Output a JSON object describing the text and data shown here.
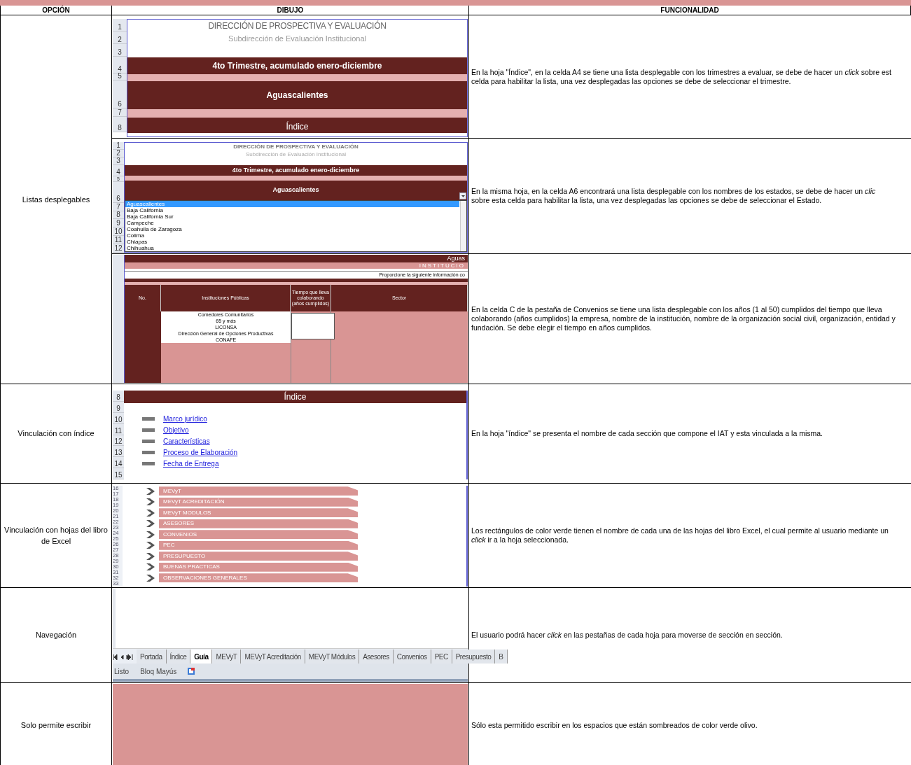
{
  "header": {
    "columns": [
      "OPCIÓN",
      "DIBUJO",
      "FUNCIONALIDAD"
    ]
  },
  "rows": [
    {
      "option": "Listas desplegables",
      "items": [
        {
          "drawing": {
            "kind": "portada",
            "row_numbers": [
              "1",
              "2",
              "3",
              "4",
              "5",
              "6",
              "7",
              "8"
            ],
            "title": "DIRECCIÓN DE PROSPECTIVA Y EVALUACIÓN",
            "subtitle": "Subdirección de Evaluación Institucional",
            "period": "4to Trimestre, acumulado enero-diciembre",
            "state": "Aguascalientes",
            "sheet": "Índice"
          },
          "text": "En la hoja \"Índice\", en la celda A4 se tiene una lista desplegable con los trimestres a evaluar, se debe de hacer un *click* sobre est\ncelda para habilitar la lista, una vez desplegadas las opciones se debe de seleccionar el trimestre."
        },
        {
          "drawing": {
            "kind": "dropdown",
            "row_numbers": [
              "1",
              "2",
              "3",
              "4",
              "5",
              "6",
              "7",
              "8",
              "9",
              "10",
              "11",
              "12"
            ],
            "title": "DIRECCIÓN DE PROSPECTIVA Y EVALUACIÓN",
            "subtitle": "Subdirección de Evaluación Institucional",
            "period": "4to Trimestre, acumulado enero-diciembre",
            "state": "Aguascalientes",
            "options": [
              {
                "label": "Aguascalientes",
                "selected": true
              },
              {
                "label": "Baja California",
                "selected": false
              },
              {
                "label": "Baja California Sur",
                "selected": false
              },
              {
                "label": "Campeche",
                "selected": false
              },
              {
                "label": "Coahuila de Zaragoza",
                "selected": false
              },
              {
                "label": "Colima",
                "selected": false
              },
              {
                "label": "Chiapas",
                "selected": false
              },
              {
                "label": "Chihuahua",
                "selected": false
              }
            ]
          },
          "text": "En la misma hoja, en la celda A6 encontrará una lista desplegable con los nombres de los estados, se debe de hacer un *clic*\nsobre esta celda para habilitar la lista, una vez desplegadas las opciones se debe de seleccionar el Estado."
        },
        {
          "drawing": {
            "kind": "convenios",
            "title": "Aguas",
            "subtitle": "INSTITUCIO",
            "instruction": "Proporcione la siguiente información co",
            "columns": [
              "No.",
              "Instituciones Públicas",
              "Tiempo que lleva colaborando (años cumplidos)",
              "Sector"
            ],
            "institutions": [
              "Comedores Comunitarios",
              "65 y más",
              "LICONSA",
              "Dirección General de Opciones Productivas",
              "CONAFE"
            ]
          },
          "text": "En la celda C de la pestaña de Convenios se tiene una lista desplegable con los años (1 al 50) cumplidos del tiempo que lleva colaborando (años cumplidos) la empresa, nombre de la institución, nombre de la organización social civil, organización, entidad y fundación. Se debe elegir el tiempo en años cumplidos."
        }
      ]
    },
    {
      "option": "Vinculación con índice",
      "items": [
        {
          "drawing": {
            "kind": "indice",
            "row_numbers": [
              "8",
              "9",
              "10",
              "11",
              "12",
              "13",
              "14",
              "15"
            ],
            "heading": "Índice",
            "links": [
              "Marco jurídico",
              "Objetivo",
              "Características",
              "Proceso de Elaboración",
              "Fecha de Entrega"
            ]
          },
          "text": "En la hoja \"índice\" se presenta el nombre de cada sección que compone el IAT y esta vinculada a la misma."
        }
      ]
    },
    {
      "option": "Vinculación con hojas del libro de Excel",
      "items": [
        {
          "drawing": {
            "kind": "hojas",
            "row_numbers": [
              "16",
              "17",
              "18",
              "19",
              "20",
              "21",
              "22",
              "23",
              "24",
              "25",
              "26",
              "27",
              "28",
              "29",
              "30",
              "31",
              "32",
              "33"
            ],
            "sheets": [
              "MEVyT",
              "MEVyT ACREDITACIÓN",
              "MEVyT MODULOS",
              "ASESORES",
              "CONVENIOS",
              "PEC",
              "PRESUPUESTO",
              "BUENAS PRACTICAS",
              "OBSERVACIONES GENERALES"
            ]
          },
          "text": "Los rectángulos de color verde tienen el nombre de cada una de las hojas del libro Excel, el cual permite al usuario mediante un\n*click*  ir a la hoja seleccionada."
        }
      ]
    },
    {
      "option": "Navegación",
      "items": [
        {
          "drawing": {
            "kind": "pestanas",
            "tabs": [
              {
                "label": "Portada",
                "selected": false
              },
              {
                "label": "Índice",
                "selected": false
              },
              {
                "label": "Guía",
                "selected": true
              },
              {
                "label": "MEVyT",
                "selected": false
              },
              {
                "label": "MEVyT Acreditación",
                "selected": false
              },
              {
                "label": "MEVyT Módulos",
                "selected": false
              },
              {
                "label": "Asesores",
                "selected": false
              },
              {
                "label": "Convenios",
                "selected": false
              },
              {
                "label": "PEC",
                "selected": false
              },
              {
                "label": "Presupuesto",
                "selected": false
              },
              {
                "label": "B",
                "selected": false
              }
            ],
            "status": [
              "Listo",
              "Bloq Mayús"
            ]
          },
          "text": "El usuario podrá hacer *click*  en las pestañas de cada hoja para moverse de sección en sección."
        }
      ]
    },
    {
      "option": "Solo permite escribir",
      "items": [
        {
          "drawing": {
            "kind": "sombreado"
          },
          "text": "Sólo esta permitido escribir en los espacios que están sombreados de color verde olivo."
        }
      ]
    }
  ]
}
